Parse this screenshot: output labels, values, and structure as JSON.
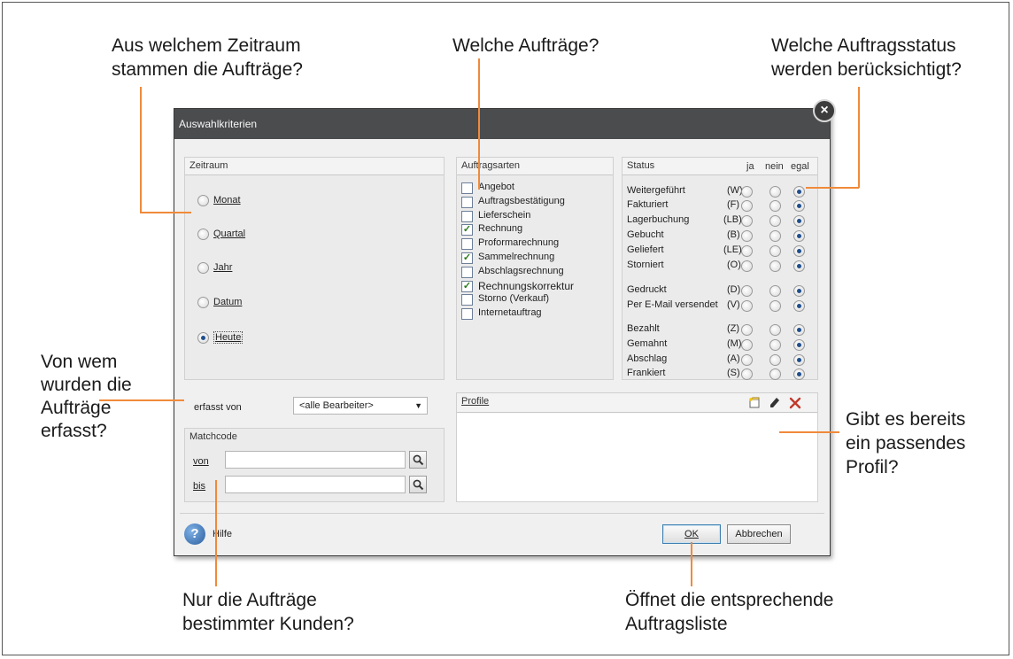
{
  "callouts": {
    "zeitraum": [
      "Aus welchem Zeitraum",
      "stammen die Aufträge?"
    ],
    "welche": [
      "Welche Aufträge?"
    ],
    "status": [
      "Welche Auftragsstatus",
      "werden berücksichtigt?"
    ],
    "vonwem": [
      "Von wem",
      "wurden die",
      "Aufträge",
      "erfasst?"
    ],
    "profil": [
      "Gibt es bereits",
      "ein passendes",
      "Profil?"
    ],
    "kunden": [
      "Nur die Aufträge",
      "bestimmter Kunden?"
    ],
    "liste": [
      "Öffnet die entsprechende",
      "Auftragsliste"
    ]
  },
  "dialog": {
    "title": "Auswahlkriterien",
    "close_glyph": "×",
    "zeitraum": {
      "header": "Zeitraum",
      "options": [
        {
          "label": "Monat",
          "selected": false
        },
        {
          "label": "Quartal",
          "selected": false
        },
        {
          "label": "Jahr",
          "selected": false
        },
        {
          "label": "Datum",
          "selected": false
        },
        {
          "label": "Heute",
          "selected": true
        }
      ]
    },
    "auftragsarten": {
      "header": "Auftragsarten",
      "items": [
        {
          "label": "Angebot",
          "checked": false
        },
        {
          "label": "Auftragsbestätigung",
          "checked": false
        },
        {
          "label": "Lieferschein",
          "checked": false
        },
        {
          "label": "Rechnung",
          "checked": true
        },
        {
          "label": "Proformarechnung",
          "checked": false
        },
        {
          "label": "Sammelrechnung",
          "checked": true
        },
        {
          "label": "Abschlagsrechnung",
          "checked": false
        },
        {
          "label": "Rechnungskorrektur",
          "checked": true
        },
        {
          "label": "Storno (Verkauf)",
          "checked": false
        },
        {
          "label": "Internetauftrag",
          "checked": false
        }
      ]
    },
    "status": {
      "header": "Status",
      "col_ja": "ja",
      "col_nein": "nein",
      "col_egal": "egal",
      "rows": [
        {
          "label": "Weitergeführt",
          "code": "(W)",
          "value": "egal"
        },
        {
          "label": "Fakturiert",
          "code": "(F)",
          "value": "egal"
        },
        {
          "label": "Lagerbuchung",
          "code": "(LB)",
          "value": "egal"
        },
        {
          "label": "Gebucht",
          "code": "(B)",
          "value": "egal"
        },
        {
          "label": "Geliefert",
          "code": "(LE)",
          "value": "egal"
        },
        {
          "label": "Storniert",
          "code": "(O)",
          "value": "egal"
        },
        {
          "label": "Gedruckt",
          "code": "(D)",
          "value": "egal"
        },
        {
          "label": "Per E-Mail versendet",
          "code": "(V)",
          "value": "egal"
        },
        {
          "label": "Bezahlt",
          "code": "(Z)",
          "value": "egal"
        },
        {
          "label": "Gemahnt",
          "code": "(M)",
          "value": "egal"
        },
        {
          "label": "Abschlag",
          "code": "(A)",
          "value": "egal"
        },
        {
          "label": "Frankiert",
          "code": "(S)",
          "value": "egal"
        }
      ]
    },
    "erfasst": {
      "label": "erfasst von",
      "value": "<alle Bearbeiter>"
    },
    "matchcode": {
      "header": "Matchcode",
      "von_label": "von",
      "bis_label": "bis",
      "von_value": "",
      "bis_value": ""
    },
    "profile": {
      "header": "Profile"
    },
    "footer": {
      "help_label": "Hilfe",
      "ok_label": "OK",
      "cancel_label": "Abbrechen"
    }
  }
}
